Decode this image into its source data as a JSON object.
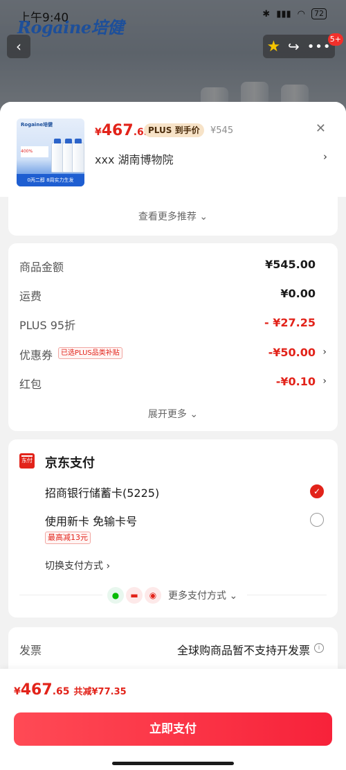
{
  "status_bar": {
    "time": "上午9:40",
    "battery": "72"
  },
  "brand": {
    "logo_text": "Rogaine培健"
  },
  "top_actions": {
    "badge": "5+"
  },
  "product": {
    "price_yen": "¥",
    "price_int": "467",
    "price_dec": ".65",
    "plus_tag": "PLUS 到手价",
    "original_price": "¥545",
    "store": "xxx  湖南博物院",
    "image_promo": "400%",
    "image_band": "0丙二醇 8周实力生发"
  },
  "more_recommend": "查看更多推荐 ⌄",
  "amounts": {
    "rows": [
      {
        "label": "商品金额",
        "value": "¥545.00"
      },
      {
        "label": "运费",
        "value": "¥0.00"
      },
      {
        "label": "PLUS 95折",
        "value": "- ¥27.25"
      },
      {
        "label": "优惠券",
        "tag": "已选PLUS品类补贴",
        "value": "-¥50.00"
      },
      {
        "label": "红包",
        "value": "-¥0.10"
      }
    ],
    "expand": "展开更多 ⌄"
  },
  "payment": {
    "title": "京东支付",
    "icon_text": "东付",
    "option_card": "招商银行储蓄卡(5225)",
    "option_new": "使用新卡 免输卡号",
    "reduce_tag": "最高减13元",
    "switch": "切换支付方式 ›",
    "more": "更多支付方式 ⌄"
  },
  "invoice": {
    "label": "发票",
    "value": "全球购商品暂不支持开发票"
  },
  "footer": {
    "total_yen": "¥",
    "total_int": "467",
    "total_dec": ".65",
    "discount": "共减¥77.35",
    "pay_button": "立即支付"
  },
  "colors": {
    "accent": "#e2231a",
    "button": "#f7223a",
    "plus_tag_bg": "#f7e3c8"
  }
}
